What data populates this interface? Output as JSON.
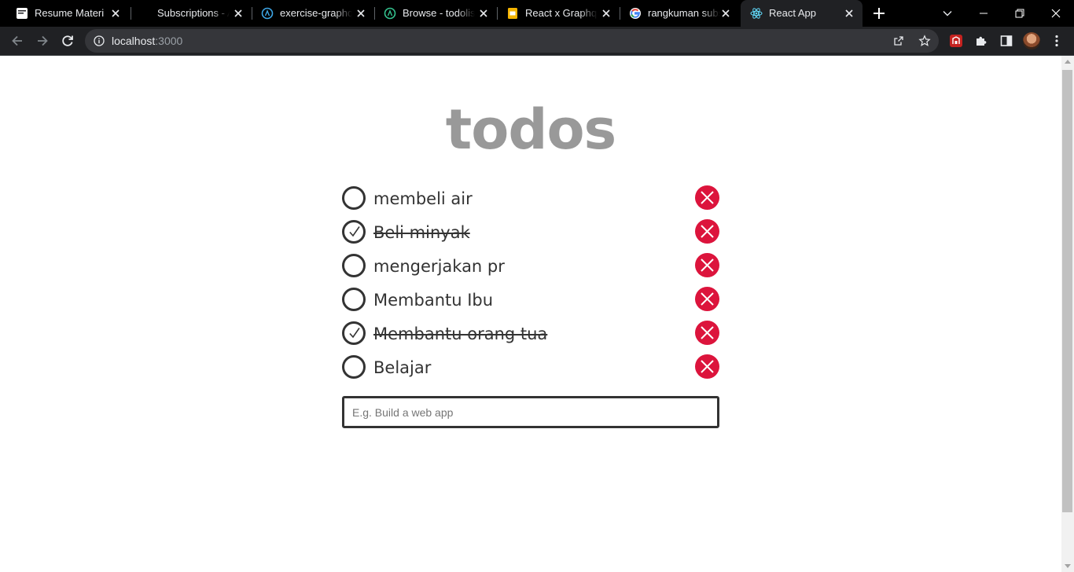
{
  "browser": {
    "tabs": [
      {
        "title": "Resume Materi",
        "icon": "page-icon"
      },
      {
        "title": "Subscriptions - Ap",
        "icon": "none"
      },
      {
        "title": "exercise-graphql",
        "icon": "hasura-icon"
      },
      {
        "title": "Browse - todolist",
        "icon": "hasura-icon"
      },
      {
        "title": "React x Graphql",
        "icon": "slides-icon"
      },
      {
        "title": "rangkuman subsc",
        "icon": "google-icon"
      },
      {
        "title": "React App",
        "icon": "react-icon",
        "active": true
      }
    ],
    "address": {
      "host": "localhost",
      "port": ":3000"
    }
  },
  "app": {
    "title": "todos",
    "todos": [
      {
        "label": "membeli air",
        "completed": false
      },
      {
        "label": "Beli minyak",
        "completed": true
      },
      {
        "label": "mengerjakan pr",
        "completed": false
      },
      {
        "label": "Membantu Ibu",
        "completed": false
      },
      {
        "label": "Membantu orang tua",
        "completed": true
      },
      {
        "label": "Belajar",
        "completed": false
      }
    ],
    "new_todo": {
      "value": "",
      "placeholder": "E.g. Build a web app"
    }
  },
  "colors": {
    "title": "#999999",
    "text": "#333333",
    "delete": "#dc143c",
    "chrome_bg": "#202124",
    "tabstrip_bg": "#000000"
  }
}
